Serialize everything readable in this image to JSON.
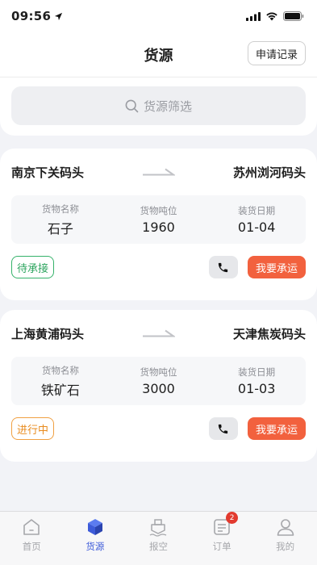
{
  "status_bar": {
    "time": "09:56"
  },
  "header": {
    "title": "货源",
    "record_button": "申请记录"
  },
  "search": {
    "placeholder": "货源筛选"
  },
  "cards": [
    {
      "origin": "南京下关码头",
      "destination": "苏州浏河码头",
      "fields": [
        {
          "label": "货物名称",
          "value": "石子"
        },
        {
          "label": "货物吨位",
          "value": "1960"
        },
        {
          "label": "装货日期",
          "value": "01-04"
        }
      ],
      "status": "待承接",
      "status_color": "#2ea55f",
      "accept_label": "我要承运"
    },
    {
      "origin": "上海黄浦码头",
      "destination": "天津焦炭码头",
      "fields": [
        {
          "label": "货物名称",
          "value": "铁矿石"
        },
        {
          "label": "货物吨位",
          "value": "3000"
        },
        {
          "label": "装货日期",
          "value": "01-03"
        }
      ],
      "status": "进行中",
      "status_color": "#e88b1e",
      "accept_label": "我要承运"
    }
  ],
  "tabbar": {
    "items": [
      {
        "label": "首页",
        "icon": "home-icon"
      },
      {
        "label": "货源",
        "icon": "cube-icon",
        "active": true
      },
      {
        "label": "报空",
        "icon": "ship-icon"
      },
      {
        "label": "订单",
        "icon": "order-icon",
        "badge": "2"
      },
      {
        "label": "我的",
        "icon": "user-icon"
      }
    ]
  },
  "colors": {
    "accent": "#3d5bd9",
    "action": "#f2613e",
    "badge": "#e23a2f"
  }
}
